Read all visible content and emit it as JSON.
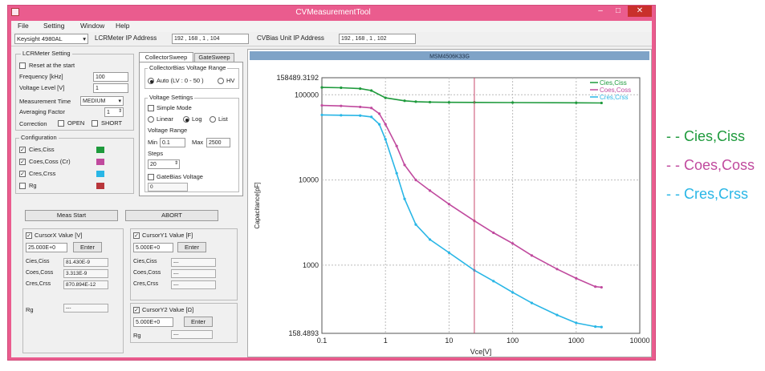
{
  "window": {
    "title": "CVMeasurementTool",
    "minimize": "–",
    "maximize": "□",
    "close": "✕"
  },
  "menu": [
    "File",
    "Setting",
    "Window",
    "Help"
  ],
  "address_bar": {
    "model": "Keysight 4980AL",
    "lcr_label": "LCRMeter IP Address",
    "lcr_ip": [
      "192",
      "168",
      "1",
      "104"
    ],
    "cvbias_label": "CVBias Unit IP Address",
    "cvbias_ip": [
      "192",
      "168",
      "1",
      "102"
    ]
  },
  "lcr": {
    "title": "LCRMeter Setting",
    "reset_label": "Reset at the start",
    "frequency_label": "Frequency [kHz]",
    "frequency": "100",
    "voltage_label": "Voltage Level [V]",
    "voltage": "1",
    "meas_time_label": "Measurement Time",
    "meas_time": "MEDIUM",
    "avg_label": "Averaging Factor",
    "avg": "1",
    "correction_label": "Correction",
    "open_label": "OPEN",
    "short_label": "SHORT"
  },
  "config": {
    "title": "Configuration",
    "items": [
      {
        "label": "Cies,Ciss",
        "checked": "✓",
        "color": "#1e9a3c"
      },
      {
        "label": "Coes,Coss (Cr)",
        "checked": "✓",
        "color": "#c04a9e"
      },
      {
        "label": "Cres,Crss",
        "checked": "✓",
        "color": "#29b6e6"
      },
      {
        "label": "Rg",
        "checked": "",
        "color": "#b8363b"
      }
    ]
  },
  "tabs": [
    "CollectorSweep",
    "GateSweep"
  ],
  "sweep": {
    "bias_title": "CollectorBias Voltage Range",
    "auto_label": "Auto (LV : 0 - 50 )",
    "hv_label": "HV",
    "vs_title": "Voltage Settings",
    "simple_label": "Simple Mode",
    "linear_label": "Linear",
    "log_label": "Log",
    "list_label": "List",
    "range_label": "Voltage Range",
    "min_label": "Min",
    "min": "0.1",
    "max_label": "Max",
    "max": "2500",
    "steps_label": "Steps",
    "steps": "20",
    "gatebias_label": "GateBias Voltage",
    "gatebias": "0"
  },
  "buttons": {
    "start": "Meas Start",
    "abort": "ABORT",
    "enter": "Enter"
  },
  "cursor_x": {
    "label": "CursorX Value [V]",
    "value": "25.000E+0",
    "rows": [
      {
        "label": "Cies,Ciss",
        "value": "81.430E-9"
      },
      {
        "label": "Coes,Coss",
        "value": "3.313E-9"
      },
      {
        "label": "Cres,Crss",
        "value": "870.894E-12"
      }
    ],
    "rg_label": "Rg",
    "rg_value": "---"
  },
  "cursor_y1": {
    "label": "CursorY1 Value [F]",
    "value": "5.000E+0",
    "rows": [
      {
        "label": "Cies,Ciss",
        "value": "---"
      },
      {
        "label": "Coes,Coss",
        "value": "---"
      },
      {
        "label": "Cres,Crss",
        "value": "---"
      }
    ]
  },
  "cursor_y2": {
    "label": "CursorY2 Value [Ω]",
    "value": "5.000E+0",
    "rg_label": "Rg",
    "rg_value": "---"
  },
  "chart_data": {
    "type": "line",
    "title": "MSM4506K33G",
    "xlabel": "Vce[V]",
    "ylabel": "Capacitance[pF]",
    "x_scale": "log",
    "y_scale": "log",
    "xlim": [
      0.1,
      10000
    ],
    "ylim": [
      158.4893,
      158489.3192
    ],
    "x_ticks": [
      "0.1",
      "1",
      "10",
      "100",
      "1000",
      "10000"
    ],
    "y_ticks": [
      "158489.3192",
      "100000",
      "10000",
      "1000",
      "158.4893"
    ],
    "grid": true,
    "legend_position": "top-right",
    "cursor_x": 25,
    "series": [
      {
        "name": "Cies,Ciss",
        "color": "#1e9a3c",
        "x": [
          0.1,
          0.2,
          0.4,
          0.6,
          1,
          2,
          3,
          5,
          10,
          25,
          100,
          1000,
          2500
        ],
        "y": [
          122000,
          121000,
          118000,
          112000,
          92000,
          85000,
          83000,
          82000,
          81500,
          81430,
          81000,
          80500,
          80200
        ]
      },
      {
        "name": "Coes,Coss",
        "color": "#c04a9e",
        "x": [
          0.1,
          0.2,
          0.4,
          0.6,
          0.8,
          1,
          1.5,
          2,
          3,
          5,
          10,
          25,
          50,
          100,
          200,
          500,
          1000,
          2000,
          2500
        ],
        "y": [
          75000,
          74000,
          72000,
          70000,
          60000,
          45000,
          25000,
          15000,
          10000,
          7500,
          5200,
          3313,
          2400,
          1800,
          1300,
          900,
          700,
          560,
          550
        ]
      },
      {
        "name": "Cres,Crss",
        "color": "#29b6e6",
        "x": [
          0.1,
          0.2,
          0.4,
          0.6,
          0.8,
          1,
          1.5,
          2,
          3,
          5,
          10,
          25,
          50,
          100,
          200,
          500,
          1000,
          2000,
          2500
        ],
        "y": [
          58000,
          57500,
          57000,
          55000,
          45000,
          30000,
          12000,
          6000,
          3000,
          2000,
          1400,
          870.894,
          650,
          480,
          360,
          260,
          210,
          190,
          188
        ]
      }
    ]
  },
  "outside_legend": [
    {
      "label": "- - Cies,Ciss",
      "color": "#1e9a3c"
    },
    {
      "label": "- - Coes,Coss",
      "color": "#c04a9e"
    },
    {
      "label": "- - Cres,Crss",
      "color": "#29b6e6"
    }
  ]
}
